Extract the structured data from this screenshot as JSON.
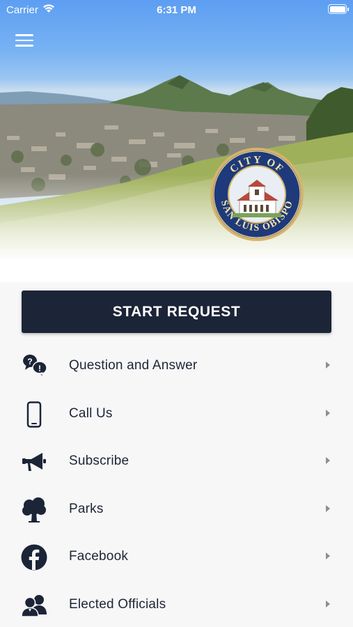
{
  "status_bar": {
    "carrier": "Carrier",
    "time": "6:31 PM"
  },
  "header": {
    "seal_text": "CITY OF SAN LUIS OBISPO"
  },
  "start_request": {
    "label": "START REQUEST"
  },
  "menu": {
    "items": [
      {
        "label": "Question and Answer",
        "icon": "question-answer-icon"
      },
      {
        "label": "Call Us",
        "icon": "phone-icon"
      },
      {
        "label": "Subscribe",
        "icon": "megaphone-icon"
      },
      {
        "label": "Parks",
        "icon": "tree-icon"
      },
      {
        "label": "Facebook",
        "icon": "facebook-icon"
      },
      {
        "label": "Elected Officials",
        "icon": "people-icon"
      }
    ]
  },
  "colors": {
    "primary": "#1c2537",
    "seal_blue": "#1f3a7a",
    "seal_gold": "#d6b46a",
    "chevron": "#8a8e96"
  }
}
